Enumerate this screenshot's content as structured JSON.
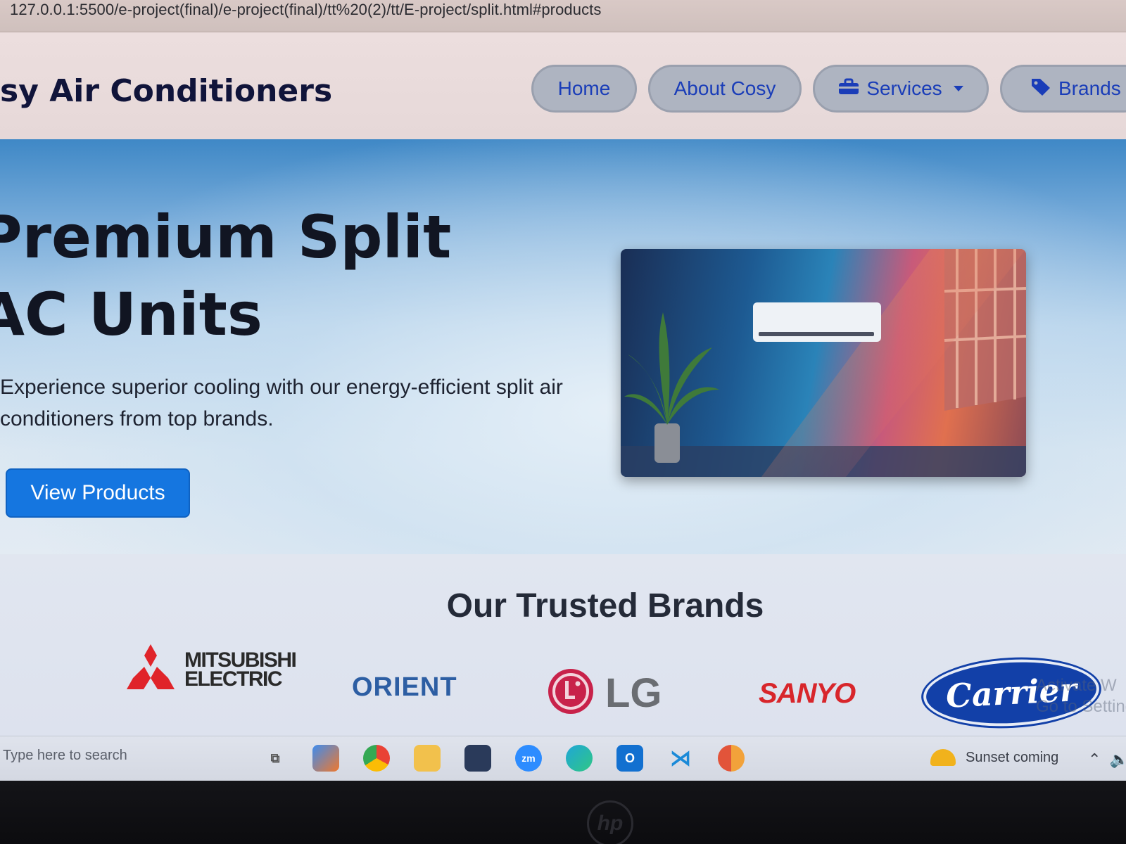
{
  "browser": {
    "url": "127.0.0.1:5500/e-project(final)/e-project(final)/tt%20(2)/tt/E-project/split.html#products"
  },
  "header": {
    "title": "Cosy Air Conditioners",
    "title_visible": "sy Air Conditioners",
    "nav": [
      {
        "label": "Home",
        "icon": null
      },
      {
        "label": "About Cosy",
        "icon": null
      },
      {
        "label": "Services",
        "icon": "toolbox-icon",
        "has_dropdown": true
      },
      {
        "label": "Brands",
        "icon": "tag-icon"
      }
    ]
  },
  "hero": {
    "title": "Premium Split AC Units",
    "description": "Experience superior cooling with our energy-efficient split air conditioners from top brands.",
    "cta_label": "View Products",
    "image_alt": "Split air conditioner mounted on a wall beside a potted palm and sunlit window"
  },
  "brands": {
    "title": "Our Trusted Brands",
    "items": [
      {
        "name": "MITSUBISHI ELECTRIC",
        "line1": "MITSUBISHI",
        "line2": "ELECTRIC"
      },
      {
        "name": "ORIENT",
        "text": "ORIENT"
      },
      {
        "name": "LG",
        "text": "LG"
      },
      {
        "name": "SANYO",
        "text": "SANYO"
      },
      {
        "name": "Carrier",
        "text": "Carrier"
      }
    ]
  },
  "os_watermark": {
    "line1": "Activate W",
    "line2": "Go to Setting"
  },
  "taskbar": {
    "search_placeholder": "Type here to search",
    "weather_text": "Sunset coming",
    "apps": [
      "task-view-icon",
      "widgets-icon",
      "chrome-icon",
      "file-explorer-icon",
      "terminal-icon",
      "zoom-icon",
      "edge-icon",
      "outlook-icon",
      "vscode-icon",
      "chrome-canary-icon"
    ]
  },
  "colors": {
    "nav_text": "#1a3db8",
    "cta_bg": "#1576e0",
    "title_text": "#10143a"
  }
}
